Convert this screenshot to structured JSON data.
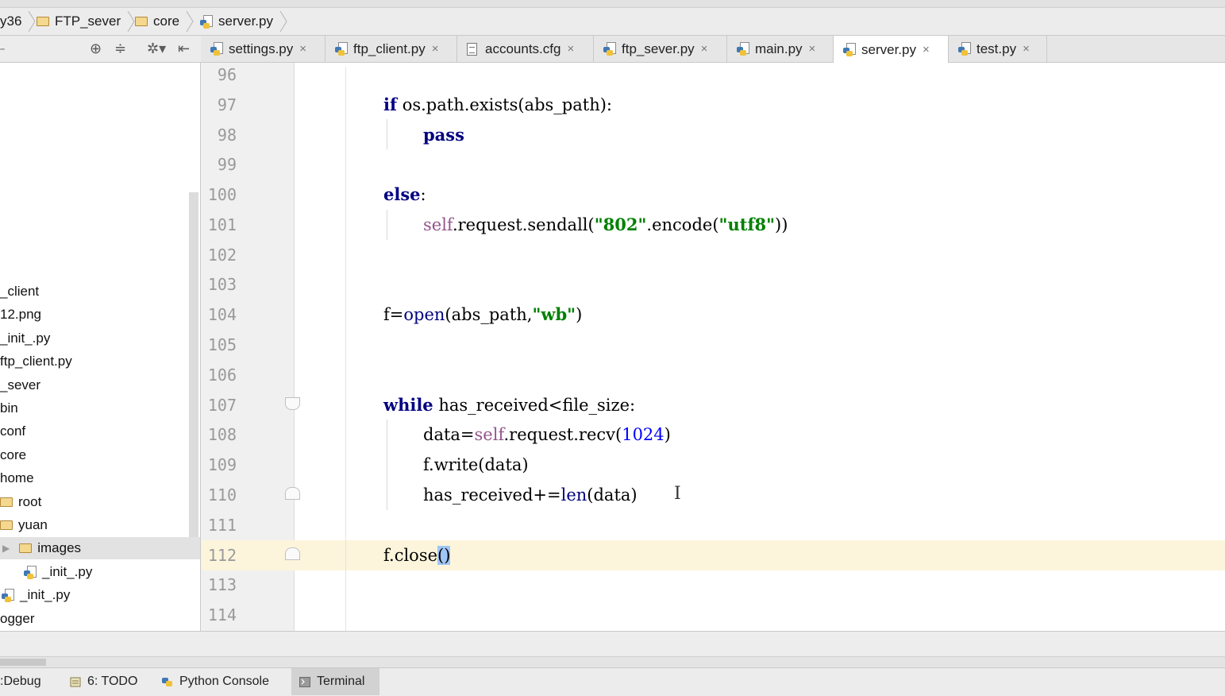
{
  "breadcrumb": {
    "items": [
      "y36",
      "FTP_sever",
      "core",
      "server.py"
    ]
  },
  "tabs": [
    {
      "label": "settings.py",
      "icon": "python-file-icon",
      "active": false
    },
    {
      "label": "ftp_client.py",
      "icon": "python-file-icon",
      "active": false
    },
    {
      "label": "accounts.cfg",
      "icon": "text-file-icon",
      "active": false
    },
    {
      "label": "ftp_sever.py",
      "icon": "python-file-icon",
      "active": false
    },
    {
      "label": "main.py",
      "icon": "python-file-icon",
      "active": false
    },
    {
      "label": "server.py",
      "icon": "python-file-icon",
      "active": true
    },
    {
      "label": "test.py",
      "icon": "python-file-icon",
      "active": false
    }
  ],
  "tab_close_glyph": "×",
  "tree": [
    {
      "label": "_client"
    },
    {
      "label": "12.png"
    },
    {
      "label": "_init_.py"
    },
    {
      "label": "ftp_client.py"
    },
    {
      "label": "_sever"
    },
    {
      "label": "bin"
    },
    {
      "label": "conf"
    },
    {
      "label": "core"
    },
    {
      "label": "home"
    },
    {
      "label": "root",
      "icon": "folder-icon"
    },
    {
      "label": "yuan",
      "icon": "folder-icon"
    },
    {
      "label": "images",
      "icon": "folder-icon",
      "selected": true
    },
    {
      "label": "_init_.py",
      "icon": "python-file-icon"
    },
    {
      "label": "_init_.py",
      "icon": "python-file-icon"
    },
    {
      "label": "ogger"
    }
  ],
  "editor": {
    "line_numbers": [
      "96",
      "97",
      "98",
      "99",
      "100",
      "101",
      "102",
      "103",
      "104",
      "105",
      "106",
      "107",
      "108",
      "109",
      "110",
      "111",
      "112",
      "113",
      "114"
    ],
    "current_line": "112",
    "code": {
      "l97": {
        "kw": "if",
        "rest": " os.path.exists(abs_path):"
      },
      "l98": {
        "kw": "pass"
      },
      "l100": {
        "kw": "else",
        "rest": ":"
      },
      "l101": {
        "self": "self",
        "a": ".request.sendall(",
        "s1": "\"802\"",
        "b": ".encode(",
        "s2": "\"utf8\"",
        "c": "))"
      },
      "l104": {
        "a": "f=",
        "open": "open",
        "b": "(abs_path,",
        "s": "\"wb\"",
        "c": ")"
      },
      "l107": {
        "kw": "while",
        "rest": " has_received<file_size:"
      },
      "l108": {
        "a": "data=",
        "self": "self",
        "b": ".request.recv(",
        "n": "1024",
        "c": ")"
      },
      "l109": {
        "a": "f.write(data)"
      },
      "l110": {
        "a": "has_received+=",
        "len": "len",
        "b": "(data)"
      },
      "l112": {
        "a": "f.close",
        "b": "()"
      }
    }
  },
  "bottom_tabs": [
    {
      "label": "Debug",
      "prefix": ": "
    },
    {
      "label": "6: TODO"
    },
    {
      "label": "Python Console"
    },
    {
      "label": "Terminal",
      "active": true
    }
  ],
  "colors": {
    "keyword": "#000080",
    "string": "#008000",
    "number": "#0000ff",
    "self": "#94558d",
    "current_line": "#fcf5dc",
    "brace_match": "#9fc6f5"
  }
}
